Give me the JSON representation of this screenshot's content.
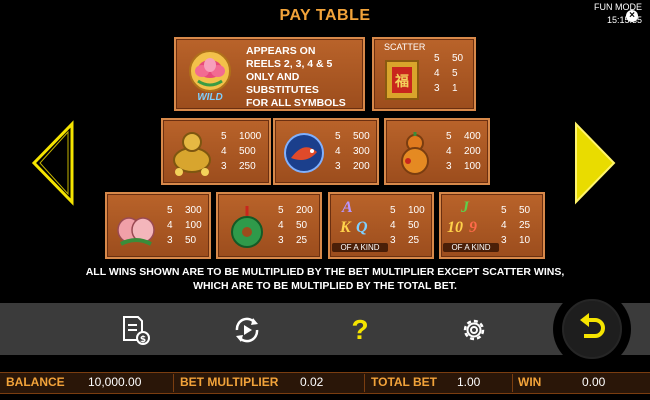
{
  "title": "PAY TABLE",
  "mode": {
    "label": "FUN MODE",
    "time": "15:15:35"
  },
  "wild": {
    "icon_text": "WILD",
    "lines": [
      "APPEARS ON",
      "REELS  2, 3, 4 & 5",
      "ONLY AND SUBSTITUTES",
      "FOR ALL SYMBOLS"
    ]
  },
  "scatter": {
    "label": "SCATTER",
    "pays": [
      {
        "n": "5",
        "v": "50"
      },
      {
        "n": "4",
        "v": "5"
      },
      {
        "n": "3",
        "v": "1"
      }
    ]
  },
  "row2": [
    {
      "name": "turtle",
      "pays": [
        {
          "n": "5",
          "v": "1000"
        },
        {
          "n": "4",
          "v": "500"
        },
        {
          "n": "3",
          "v": "250"
        }
      ]
    },
    {
      "name": "koi-fish",
      "pays": [
        {
          "n": "5",
          "v": "500"
        },
        {
          "n": "4",
          "v": "300"
        },
        {
          "n": "3",
          "v": "200"
        }
      ]
    },
    {
      "name": "gourd",
      "pays": [
        {
          "n": "5",
          "v": "400"
        },
        {
          "n": "4",
          "v": "200"
        },
        {
          "n": "3",
          "v": "100"
        }
      ]
    }
  ],
  "row3": [
    {
      "name": "peach",
      "pays": [
        {
          "n": "5",
          "v": "300"
        },
        {
          "n": "4",
          "v": "100"
        },
        {
          "n": "3",
          "v": "50"
        }
      ]
    },
    {
      "name": "jade-coin",
      "pays": [
        {
          "n": "5",
          "v": "200"
        },
        {
          "n": "4",
          "v": "50"
        },
        {
          "n": "3",
          "v": "25"
        }
      ]
    },
    {
      "name": "a-k-q",
      "letters": [
        "A",
        "K",
        "Q"
      ],
      "kind": "OF A KIND",
      "pays": [
        {
          "n": "5",
          "v": "100"
        },
        {
          "n": "4",
          "v": "50"
        },
        {
          "n": "3",
          "v": "25"
        }
      ]
    },
    {
      "name": "j-10-9",
      "letters": [
        "J",
        "10",
        "9"
      ],
      "kind": "OF A KIND",
      "pays": [
        {
          "n": "5",
          "v": "50"
        },
        {
          "n": "4",
          "v": "25"
        },
        {
          "n": "3",
          "v": "10"
        }
      ]
    }
  ],
  "note": [
    "ALL WINS SHOWN ARE TO BE MULTIPLIED BY THE BET MULTIPLIER EXCEPT SCATTER WINS,",
    "WHICH ARE TO BE MULTIPLIED BY THE TOTAL BET."
  ],
  "status": {
    "balance_label": "BALANCE",
    "balance": "10,000.00",
    "bet_mult_label": "BET MULTIPLIER",
    "bet_mult": "0.02",
    "total_bet_label": "TOTAL BET",
    "total_bet": "1.00",
    "win_label": "WIN",
    "win": "0.00"
  },
  "toolbar_icons": [
    "paytable-icon",
    "autoplay-icon",
    "help-icon",
    "settings-icon",
    "back-icon"
  ],
  "colors": {
    "accent": "#f2a33a",
    "tile": "#b05a24",
    "arrow": "#f5e400"
  }
}
